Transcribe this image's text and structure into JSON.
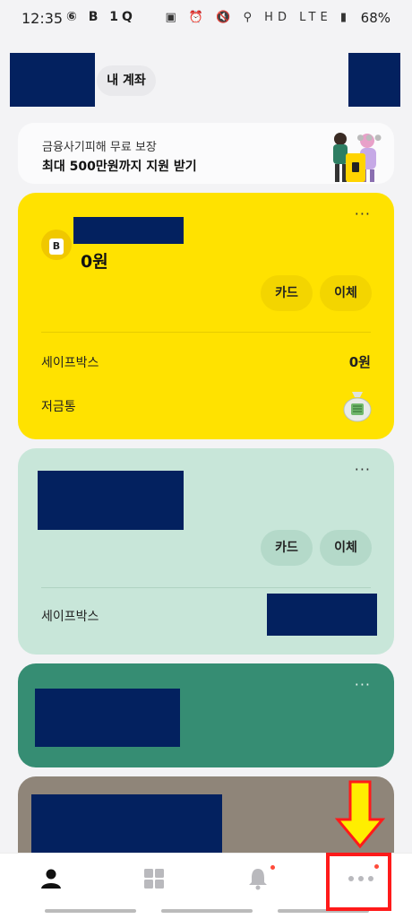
{
  "status_bar": {
    "time": "12:35",
    "left_icons": "⑥ B 1Q",
    "right_icons": "▣ ⏰ 🔇 ⚲ HD LTE ▮",
    "battery": "68%",
    "icons": [
      "photo-icon",
      "b-app-icon",
      "q-app-icon",
      "lock-icon",
      "alarm-icon",
      "mute-icon",
      "location-icon",
      "hd-voice-icon",
      "lte-icon",
      "signal-icon",
      "battery-icon"
    ]
  },
  "header": {
    "tab_label": "내 계좌"
  },
  "promo": {
    "line1": "금융사기피해 무료 보장",
    "line2": "최대 500만원까지 지원 받기",
    "illustration": "people-with-shopping-bag-illustration"
  },
  "cards": [
    {
      "more": "···",
      "balance": "0원",
      "buttons": [
        "카드",
        "이체"
      ],
      "rows": [
        {
          "label": "세이프박스",
          "value": "0원"
        },
        {
          "label": "저금통",
          "icon": "piggy-bag-icon"
        }
      ]
    },
    {
      "more": "···",
      "buttons": [
        "카드",
        "이체"
      ],
      "rows": [
        {
          "label": "세이프박스"
        }
      ]
    },
    {
      "more": "···"
    },
    {}
  ],
  "bottom_nav": {
    "items": [
      {
        "name": "profile",
        "icon": "person-icon"
      },
      {
        "name": "apps",
        "icon": "grid-icon"
      },
      {
        "name": "notifications",
        "icon": "bell-icon",
        "badge": true
      },
      {
        "name": "more",
        "icon": "more-dots-icon",
        "badge": true
      }
    ]
  },
  "colors": {
    "background": "#f3f3f5",
    "card_yellow": "#ffe200",
    "card_mint": "#c8e6d9",
    "card_green": "#368d73",
    "card_taupe": "#8f8579",
    "redaction": "#03215f",
    "badge_red": "#ff4b3a",
    "annotation_arrow": "#ffee00",
    "annotation_box": "#ff1a1a"
  }
}
